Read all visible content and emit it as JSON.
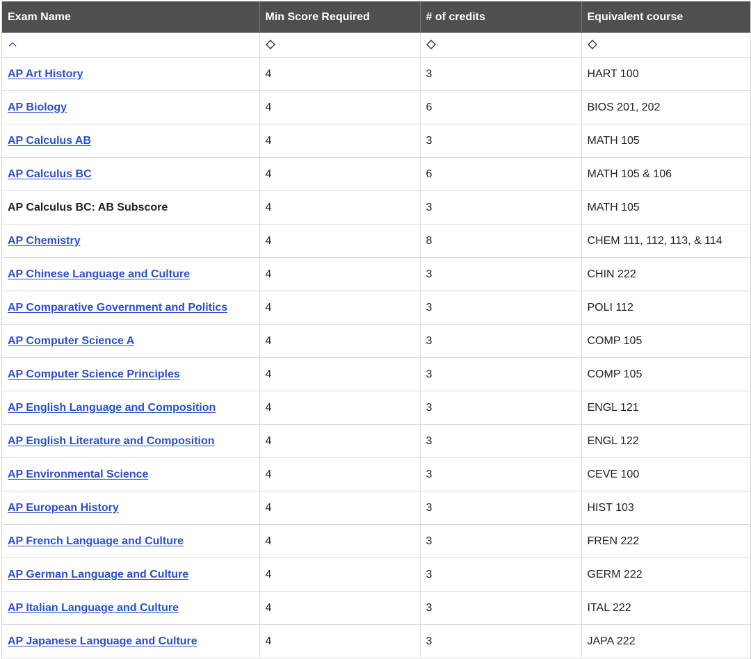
{
  "table": {
    "headers": [
      "Exam Name",
      "Min Score Required",
      "# of credits",
      "Equivalent course"
    ],
    "sort_icons": [
      "sort-ascending-icon",
      "sort-unsorted-icon",
      "sort-unsorted-icon",
      "sort-unsorted-icon"
    ],
    "rows": [
      {
        "exam": "AP Art History",
        "link": true,
        "score": "4",
        "credits": "3",
        "course": "HART 100"
      },
      {
        "exam": "AP Biology",
        "link": true,
        "score": "4",
        "credits": "6",
        "course": "BIOS 201, 202"
      },
      {
        "exam": "AP Calculus AB",
        "link": true,
        "score": "4",
        "credits": "3",
        "course": "MATH 105"
      },
      {
        "exam": "AP Calculus BC",
        "link": true,
        "score": "4",
        "credits": "6",
        "course": "MATH 105 & 106"
      },
      {
        "exam": "AP Calculus BC: AB Subscore",
        "link": false,
        "score": "4",
        "credits": "3",
        "course": "MATH 105"
      },
      {
        "exam": "AP Chemistry",
        "link": true,
        "score": "4",
        "credits": "8",
        "course": "CHEM 111, 112, 113, & 114"
      },
      {
        "exam": "AP Chinese Language and Culture",
        "link": true,
        "score": "4",
        "credits": "3",
        "course": "CHIN 222"
      },
      {
        "exam": "AP Comparative Government and Politics",
        "link": true,
        "score": "4",
        "credits": "3",
        "course": "POLI 112"
      },
      {
        "exam": "AP Computer Science A",
        "link": true,
        "score": "4",
        "credits": "3",
        "course": "COMP 105"
      },
      {
        "exam": "AP Computer Science Principles",
        "link": true,
        "score": "4",
        "credits": "3",
        "course": "COMP 105"
      },
      {
        "exam": "AP English Language and Composition",
        "link": true,
        "score": "4",
        "credits": "3",
        "course": "ENGL 121"
      },
      {
        "exam": "AP English Literature and Composition",
        "link": true,
        "score": "4",
        "credits": "3",
        "course": "ENGL 122"
      },
      {
        "exam": "AP Environmental Science",
        "link": true,
        "score": "4",
        "credits": "3",
        "course": "CEVE 100"
      },
      {
        "exam": "AP European History",
        "link": true,
        "score": "4",
        "credits": "3",
        "course": "HIST 103"
      },
      {
        "exam": "AP French Language and Culture",
        "link": true,
        "score": "4",
        "credits": "3",
        "course": "FREN 222"
      },
      {
        "exam": "AP German Language and Culture",
        "link": true,
        "score": "4",
        "credits": "3",
        "course": "GERM 222"
      },
      {
        "exam": "AP Italian Language and Culture",
        "link": true,
        "score": "4",
        "credits": "3",
        "course": "ITAL 222"
      },
      {
        "exam": "AP Japanese Language and Culture",
        "link": true,
        "score": "4",
        "credits": "3",
        "course": "JAPA 222"
      }
    ]
  },
  "colors": {
    "header_bg": "#4f4f4f",
    "header_text": "#ffffff",
    "link": "#2b4fc9",
    "sort_active": "#2b4fc9",
    "border": "#d9d9d9"
  }
}
